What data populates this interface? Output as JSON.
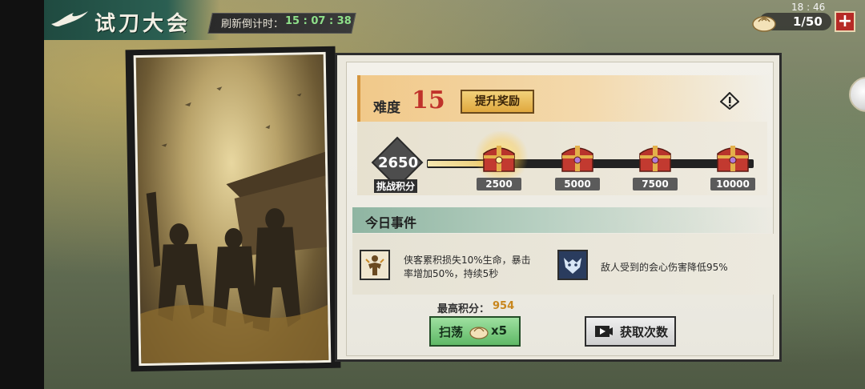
{
  "header": {
    "title": "试刀大会",
    "timer_label": "刷新倒计时：",
    "timer_value": "15 : 07 : 38"
  },
  "status": {
    "clock": "18 : 46",
    "resource_count": "1/50",
    "resource_icon": "steamed-bun-icon",
    "plus_label": "+"
  },
  "difficulty": {
    "label": "难度",
    "value": "15",
    "upgrade_label": "提升奖励",
    "info_icon": "warning-icon"
  },
  "progress": {
    "score": "2650",
    "score_label": "挑战积分",
    "current_fraction": 0.265,
    "milestones": [
      {
        "threshold": "2500",
        "state": "claimable"
      },
      {
        "threshold": "5000",
        "state": "locked"
      },
      {
        "threshold": "7500",
        "state": "locked"
      },
      {
        "threshold": "10000",
        "state": "locked"
      }
    ]
  },
  "events": {
    "title": "今日事件",
    "items": [
      {
        "icon": "hero-power-icon",
        "line1": "侠客累积损失10%生命，暴击",
        "line2": "率增加50%，持续5秒"
      },
      {
        "icon": "wolf-crest-icon",
        "line1": "敌人受到的会心伤害降低95%",
        "line2": ""
      }
    ]
  },
  "best": {
    "label": "最高积分：",
    "value": "954"
  },
  "actions": {
    "sweep_label": "扫荡",
    "sweep_count": "x5",
    "get_label": "获取次数",
    "get_icon": "video-icon"
  },
  "colors": {
    "accent_red": "#c0322a",
    "title_green": "#2b5f52",
    "sweep_green": "#5fb866",
    "score_orange": "#c8861c"
  }
}
